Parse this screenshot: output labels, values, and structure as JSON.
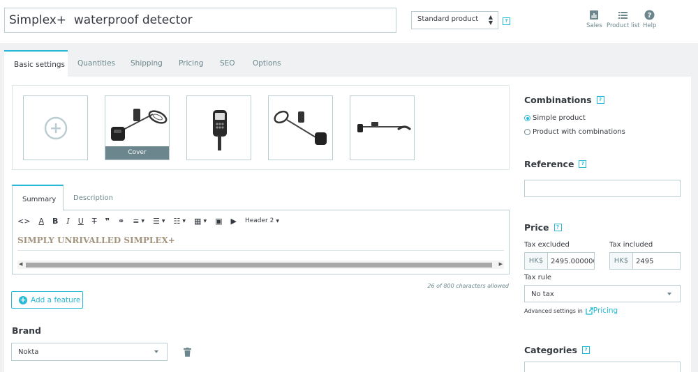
{
  "header": {
    "product_name": "Simplex+  waterproof detector",
    "product_type": "Standard product",
    "help_marker": "?",
    "tools": [
      {
        "label": "Sales",
        "icon": "bar-chart-icon"
      },
      {
        "label": "Product list",
        "icon": "list-icon"
      },
      {
        "label": "Help",
        "icon": "help-circle-icon"
      }
    ]
  },
  "tabs": [
    {
      "label": "Basic settings",
      "active": true
    },
    {
      "label": "Quantities"
    },
    {
      "label": "Shipping"
    },
    {
      "label": "Pricing"
    },
    {
      "label": "SEO"
    },
    {
      "label": "Options"
    }
  ],
  "images": {
    "cover_label": "Cover",
    "thumbnails": [
      "metal-detector-with-bag",
      "detector-control-unit",
      "detector-angled-view",
      "detector-side-view"
    ]
  },
  "description": {
    "tabs": [
      "Summary",
      "Description"
    ],
    "active_tab": "Summary",
    "toolbar": {
      "heading_select": "Header 2",
      "buttons": [
        "code-icon",
        "text-color-icon",
        "bold-icon",
        "italic-icon",
        "underline-icon",
        "strikethrough-icon",
        "quote-icon",
        "link-icon",
        "align-icon",
        "bullet-list-icon",
        "numbered-list-icon",
        "table-icon",
        "image-icon",
        "media-icon"
      ]
    },
    "content": "SIMPLY UNRIVALLED SIMPLEX+",
    "char_count": "26 of 800 characters allowed"
  },
  "add_feature_label": "Add a feature",
  "brand": {
    "heading": "Brand",
    "value": "Nokta"
  },
  "combinations": {
    "heading": "Combinations",
    "options": [
      {
        "label": "Simple product",
        "checked": true
      },
      {
        "label": "Product with combinations",
        "checked": false
      }
    ]
  },
  "reference": {
    "heading": "Reference",
    "value": ""
  },
  "price": {
    "heading": "Price",
    "tax_excluded_label": "Tax excluded",
    "tax_included_label": "Tax included",
    "currency": "HK$",
    "tax_excluded_value": "2495.000000",
    "tax_included_value": "2495",
    "tax_rule_label": "Tax rule",
    "tax_rule_value": "No tax",
    "advanced_text": "Advanced settings in",
    "advanced_link": "Pricing"
  },
  "categories": {
    "heading": "Categories"
  },
  "colors": {
    "accent": "#25b9d7",
    "text": "#363a41",
    "muted": "#6c868e",
    "border": "#bbcdd2",
    "page_bg": "#eff1f2"
  }
}
